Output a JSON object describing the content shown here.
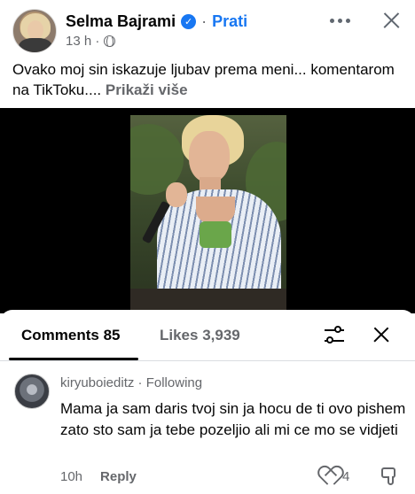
{
  "post": {
    "author_name": "Selma Bajrami",
    "verified_glyph": "✓",
    "separator": "·",
    "follow_label": "Prati",
    "timestamp": "13 h ·",
    "caption_text": "Ovako moj sin iskazuje ljubav prema meni... komentarom na TikToku....",
    "see_more_label": "Prikaži više",
    "icons": {
      "avatar": "author-avatar",
      "verified": "verified-badge-icon",
      "privacy": "globe-icon",
      "more": "more-horizontal-icon",
      "close": "close-icon"
    }
  },
  "comments_sheet": {
    "tab_comments_label": "Comments 85",
    "tab_likes_label": "Likes 3,939",
    "icons": {
      "filter": "filter-sliders-icon",
      "close": "close-icon"
    }
  },
  "comment": {
    "username": "kiryuboieditz",
    "separator": "·",
    "follow_status": "Following",
    "text": "Mama ja sam daris tvoj sin ja hocu de ti ovo pishem zato sto sam ja tebe pozeljio ali mi ce mo se vidjeti",
    "time": "10h",
    "reply_label": "Reply",
    "like_count": "4",
    "icons": {
      "like": "heart-icon",
      "dislike": "dislike-icon"
    }
  },
  "colors": {
    "link_blue": "#1877f2",
    "text_primary": "#050505",
    "text_secondary": "#65676b",
    "video_background": "#000000"
  }
}
